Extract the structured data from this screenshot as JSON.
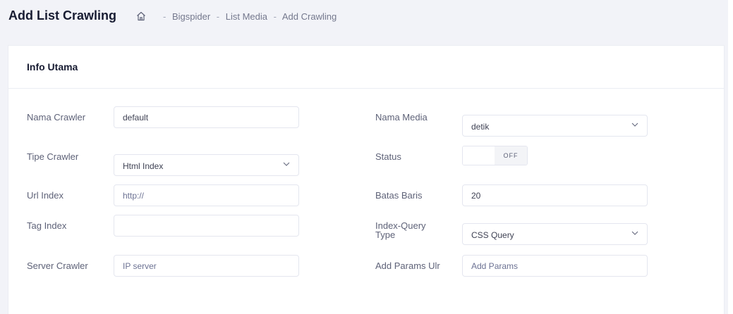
{
  "page": {
    "title": "Add List Crawling",
    "breadcrumb": [
      "Bigspider",
      "List Media",
      "Add Crawling"
    ]
  },
  "icons": [
    "home-icon",
    "chevron-down-icon"
  ],
  "card": {
    "title": "Info Utama"
  },
  "form": {
    "nama_crawler": {
      "label": "Nama Crawler",
      "value": "default"
    },
    "tipe_crawler": {
      "label": "Tipe Crawler",
      "value": "Html Index"
    },
    "url_index": {
      "label": "Url Index",
      "placeholder": "http://"
    },
    "tag_index": {
      "label": "Tag Index",
      "value": ""
    },
    "server_crawler": {
      "label": "Server Crawler",
      "placeholder": "IP server"
    },
    "nama_media": {
      "label": "Nama Media",
      "value": "detik"
    },
    "status": {
      "label": "Status",
      "toggle_text": "OFF"
    },
    "batas_baris": {
      "label": "Batas Baris",
      "value": "20"
    },
    "index_query_type": {
      "label": "Index-Query Type",
      "value": "CSS Query"
    },
    "add_params": {
      "label": "Add Params Ulr",
      "placeholder": "Add Params"
    }
  }
}
